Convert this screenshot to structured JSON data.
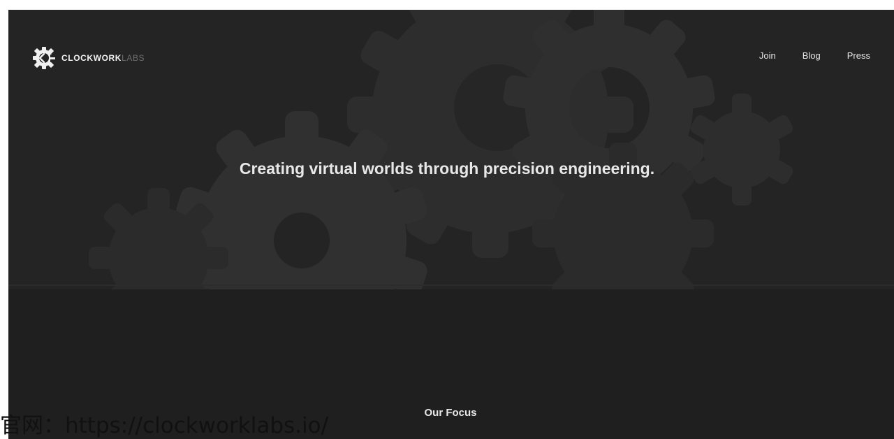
{
  "header": {
    "logo_name": "CLOCKWORK",
    "logo_suffix": "LABS",
    "logo_icon": "clockwork-gear-logo-icon",
    "nav": [
      {
        "label": "Join"
      },
      {
        "label": "Blog"
      },
      {
        "label": "Press"
      }
    ]
  },
  "hero": {
    "tagline": "Creating virtual worlds through precision engineering.",
    "background_icon": "gears-illustration"
  },
  "focus": {
    "title": "Our Focus"
  },
  "watermark": {
    "text": "官网：https://clockworklabs.io/"
  },
  "colors": {
    "background": "#1f1f1f",
    "hero_background": "#242424",
    "gear": "#303030",
    "text": "#e8e8e8"
  }
}
